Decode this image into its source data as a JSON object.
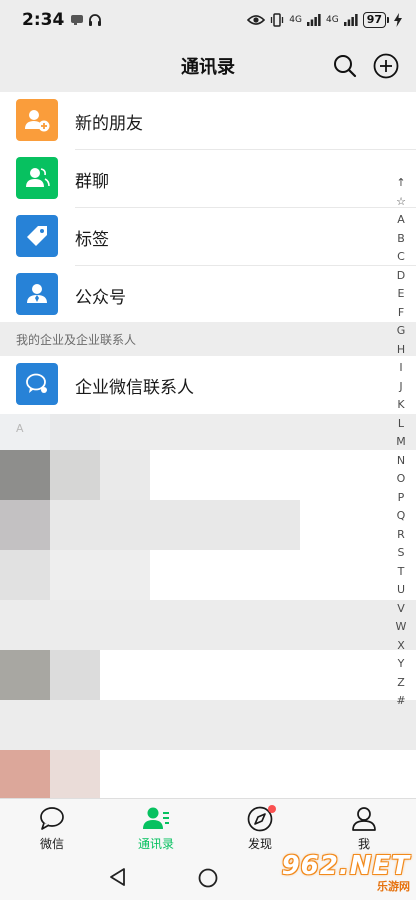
{
  "status_bar": {
    "time": "2:34",
    "network_labels": [
      "4G",
      "4G"
    ],
    "battery_level": "97"
  },
  "header": {
    "title": "通讯录",
    "search_icon": "search-icon",
    "add_icon": "plus-circle-icon"
  },
  "contacts_menu": {
    "items": [
      {
        "label": "新的朋友",
        "icon": "add-friend-icon",
        "color": "#fa9d3b"
      },
      {
        "label": "群聊",
        "icon": "group-chat-icon",
        "color": "#07c160"
      },
      {
        "label": "标签",
        "icon": "tag-icon",
        "color": "#2782d7"
      },
      {
        "label": "公众号",
        "icon": "official-account-icon",
        "color": "#2782d7"
      }
    ]
  },
  "enterprise_section": {
    "header": "我的企业及企业联系人",
    "items": [
      {
        "label": "企业微信联系人",
        "icon": "wecom-contact-icon",
        "color": "#2782d7"
      }
    ]
  },
  "contact_list": {
    "section_letter": "A"
  },
  "index_bar": {
    "letters": [
      "↑",
      "☆",
      "A",
      "B",
      "C",
      "D",
      "E",
      "F",
      "G",
      "H",
      "I",
      "J",
      "K",
      "L",
      "M",
      "N",
      "O",
      "P",
      "Q",
      "R",
      "S",
      "T",
      "U",
      "V",
      "W",
      "X",
      "Y",
      "Z",
      "#"
    ]
  },
  "tab_bar": {
    "tabs": [
      {
        "label": "微信",
        "icon": "chat-bubble-icon",
        "active": false
      },
      {
        "label": "通讯录",
        "icon": "contacts-icon",
        "active": true
      },
      {
        "label": "发现",
        "icon": "compass-icon",
        "active": false,
        "badge": true
      },
      {
        "label": "我",
        "icon": "person-icon",
        "active": false
      }
    ],
    "active_color": "#07c160"
  },
  "watermark": {
    "main": "962.NET",
    "sub": "乐游网"
  }
}
